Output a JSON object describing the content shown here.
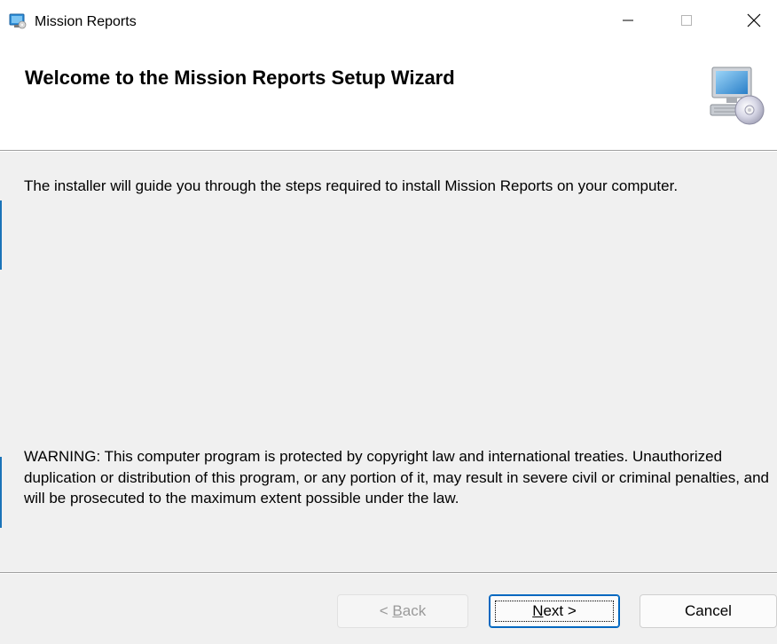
{
  "window": {
    "title": "Mission Reports",
    "controls": {
      "minimize": "minimize-icon",
      "maximize": "maximize-icon",
      "close": "close-icon"
    }
  },
  "header": {
    "title": "Welcome to the Mission Reports Setup Wizard",
    "icon": "computer-cd-icon"
  },
  "body": {
    "intro": "The installer will guide you through the steps required to install Mission Reports on your computer.",
    "warning": "WARNING: This computer program is protected by copyright law and international treaties. Unauthorized duplication or distribution of this program, or any portion of it, may result in severe civil or criminal penalties, and will be prosecuted to the maximum extent possible under the law."
  },
  "buttons": {
    "back": {
      "prefix": "< ",
      "mnemonic": "B",
      "rest": "ack",
      "enabled": false
    },
    "next": {
      "prefix": "",
      "mnemonic": "N",
      "rest": "ext >",
      "enabled": true
    },
    "cancel": {
      "label": "Cancel",
      "enabled": true
    }
  },
  "colors": {
    "accent": "#0067c0",
    "dialog_bg": "#f0f0f0",
    "header_bg": "#ffffff"
  }
}
